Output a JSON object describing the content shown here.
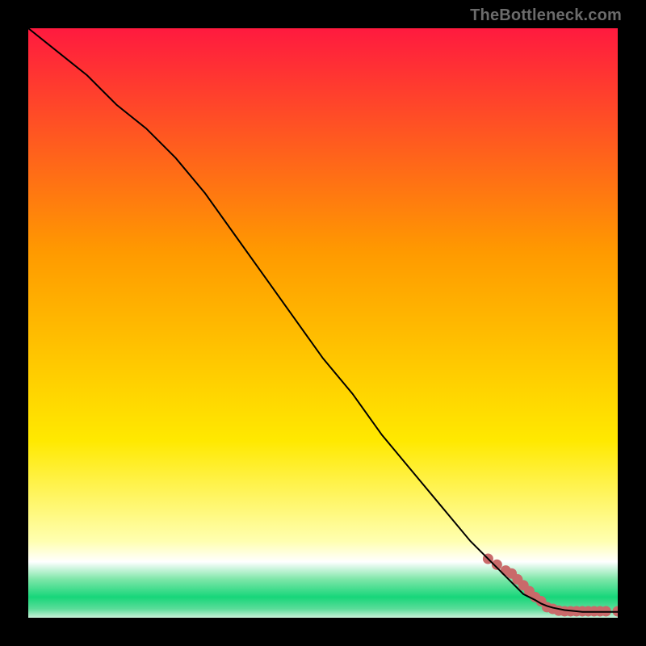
{
  "attribution": "TheBottleneck.com",
  "colors": {
    "top_red": "#ff1a3f",
    "mid_orange": "#ff9a00",
    "yellow": "#ffe900",
    "pale_yellow": "#ffffb0",
    "green": "#17d67a",
    "line_black": "#000000",
    "scatter": "#c96a6a"
  },
  "chart_data": {
    "type": "line",
    "xlim": [
      0,
      100
    ],
    "ylim": [
      0,
      100
    ],
    "title": "",
    "xlabel": "",
    "ylabel": "",
    "series": [
      {
        "name": "curve",
        "x": [
          0,
          5,
          10,
          15,
          20,
          25,
          30,
          35,
          40,
          45,
          50,
          55,
          60,
          65,
          70,
          75,
          80,
          82,
          84,
          86,
          87,
          88,
          89,
          90,
          91,
          92,
          93,
          94,
          95,
          96,
          97,
          98,
          99,
          100
        ],
        "y": [
          100,
          96,
          92,
          87,
          83,
          78,
          72,
          65,
          58,
          51,
          44,
          38,
          31,
          25,
          19,
          13,
          8,
          6,
          4,
          3,
          2.4,
          2.0,
          1.7,
          1.5,
          1.3,
          1.2,
          1.1,
          1.0,
          1.0,
          1.0,
          1.0,
          1.0,
          1.0,
          1.0
        ]
      }
    ],
    "scatter": {
      "name": "highlight-band",
      "x": [
        78,
        79.5,
        81,
        82,
        83,
        84,
        85,
        86,
        87,
        88,
        89,
        90,
        91,
        92,
        93,
        94,
        95,
        96,
        97,
        98,
        100
      ],
      "y": [
        10,
        9,
        8,
        7.5,
        6.5,
        5.5,
        4.5,
        3.5,
        2.8,
        1.8,
        1.5,
        1.2,
        1.1,
        1.1,
        1.1,
        1.1,
        1.1,
        1.1,
        1.1,
        1.1,
        1.1
      ]
    },
    "gradient_stops": [
      {
        "pos": 0.0,
        "color": "#ff1a3f"
      },
      {
        "pos": 0.38,
        "color": "#ff9a00"
      },
      {
        "pos": 0.7,
        "color": "#ffe900"
      },
      {
        "pos": 0.87,
        "color": "#ffffb0"
      },
      {
        "pos": 0.905,
        "color": "#ffffff"
      },
      {
        "pos": 0.935,
        "color": "#7de6a8"
      },
      {
        "pos": 0.965,
        "color": "#17d67a"
      },
      {
        "pos": 0.985,
        "color": "#5bdc99"
      },
      {
        "pos": 1.0,
        "color": "#c9f2da"
      }
    ]
  }
}
